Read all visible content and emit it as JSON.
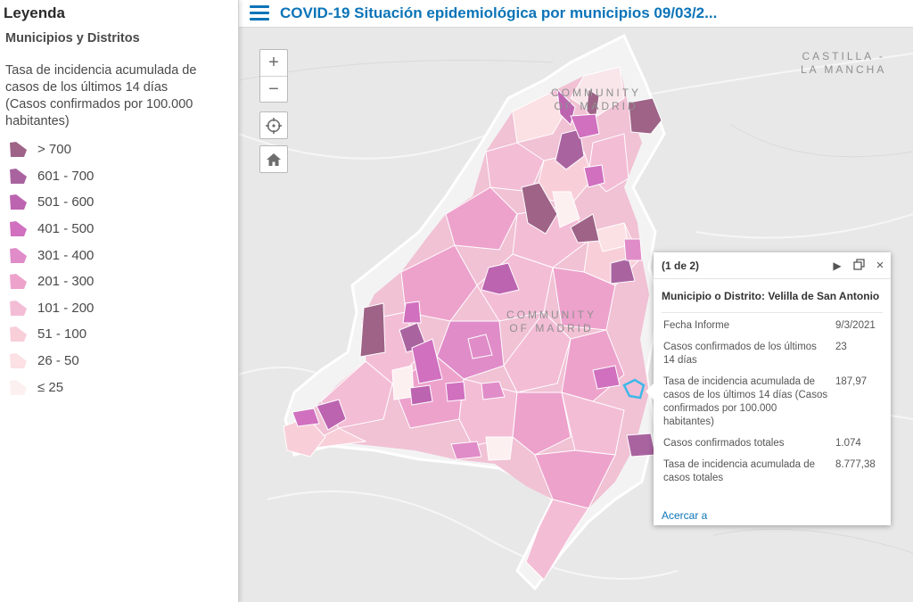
{
  "legend": {
    "title": "Leyenda",
    "layer": "Municipios y Distritos",
    "field": "Tasa de incidencia acumulada de casos de los últimos 14 días (Casos confirmados por 100.000 habitantes)",
    "classes": [
      {
        "label": "> 700",
        "color": "#9e6387"
      },
      {
        "label": "601 - 700",
        "color": "#a964a0"
      },
      {
        "label": "501 - 600",
        "color": "#bc64b0"
      },
      {
        "label": "401 - 500",
        "color": "#d070bf"
      },
      {
        "label": "301 - 400",
        "color": "#e08cc8"
      },
      {
        "label": "201 - 300",
        "color": "#eda2cc"
      },
      {
        "label": "101 - 200",
        "color": "#f4bdd6"
      },
      {
        "label": "51 - 100",
        "color": "#f8cfd9"
      },
      {
        "label": "26 - 50",
        "color": "#fbe0e4"
      },
      {
        "label": "≤ 25",
        "color": "#fdf0f0"
      }
    ]
  },
  "header": {
    "title": "COVID-19 Situación epidemiológica por municipios 09/03/2..."
  },
  "map": {
    "labels": {
      "castilla": "CASTILLA -\nLA MANCHA",
      "community_north": "COMMUNITY\nOF MADRID",
      "community_center": "COMMUNITY\nOF MADRID"
    },
    "controls": {
      "zoom_in": "+",
      "zoom_out": "−"
    },
    "selected_color": "#3db8e8"
  },
  "popup": {
    "counter": "(1 de 2)",
    "title": "Municipio o Distrito: Velilla de San Antonio",
    "fields": [
      {
        "key": "Fecha Informe",
        "value": "9/3/2021"
      },
      {
        "key": "Casos confirmados de los últimos 14 días",
        "value": "23"
      },
      {
        "key": "Tasa de incidencia acumulada de casos de los últimos 14 días (Casos confirmados por 100.000 habitantes)",
        "value": "187,97"
      },
      {
        "key": "Casos confirmados totales",
        "value": "1.074"
      },
      {
        "key": "Tasa de incidencia acumulada de casos totales",
        "value": "8.777,38"
      }
    ],
    "zoom_link": "Acercar a"
  }
}
